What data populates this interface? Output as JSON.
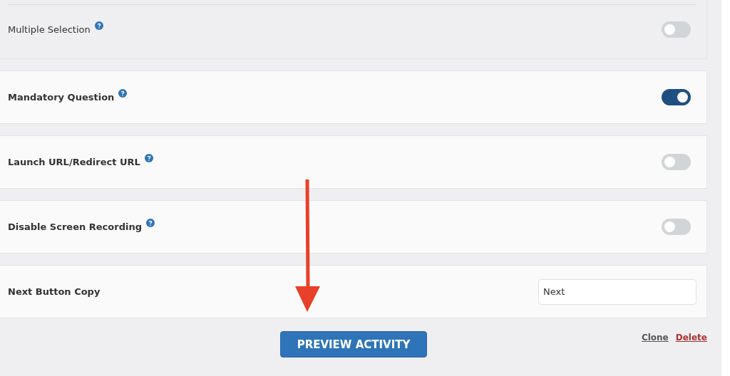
{
  "settings": [
    {
      "kind": "sub-toggle",
      "label": "Multiple Selection",
      "help": true,
      "on": false
    },
    {
      "kind": "toggle",
      "label": "Mandatory Question",
      "help": true,
      "on": true
    },
    {
      "kind": "toggle",
      "label": "Launch URL/Redirect URL",
      "help": true,
      "on": false
    },
    {
      "kind": "toggle",
      "label": "Disable Screen Recording",
      "help": true,
      "on": false
    },
    {
      "kind": "text",
      "label": "Next Button Copy",
      "value": "Next"
    }
  ],
  "preview_button": "PREVIEW ACTIVITY",
  "links": [
    {
      "label": "Clone",
      "kind": "neutral"
    },
    {
      "label": "Delete",
      "kind": "danger"
    }
  ]
}
